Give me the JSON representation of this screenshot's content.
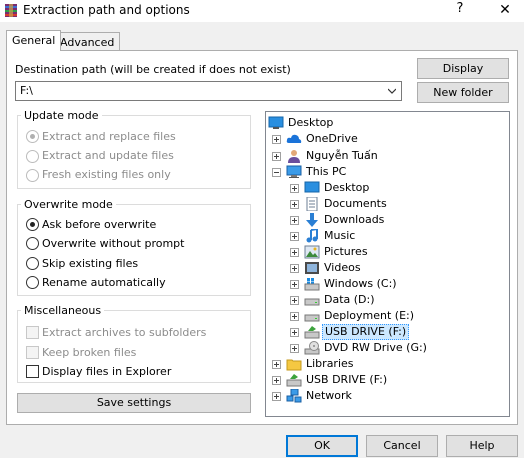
{
  "window": {
    "title": "Extraction path and options",
    "help_glyph": "?",
    "close_glyph": "✕"
  },
  "tabs": [
    {
      "label": "General"
    },
    {
      "label": "Advanced"
    }
  ],
  "destination": {
    "label": "Destination path (will be created if does not exist)",
    "value": "F:\\",
    "display_button": "Display",
    "new_folder_button": "New folder"
  },
  "update_mode": {
    "title": "Update mode",
    "options": [
      "Extract and replace files",
      "Extract and update files",
      "Fresh existing files only"
    ]
  },
  "overwrite_mode": {
    "title": "Overwrite mode",
    "options": [
      "Ask before overwrite",
      "Overwrite without prompt",
      "Skip existing files",
      "Rename automatically"
    ]
  },
  "misc": {
    "title": "Miscellaneous",
    "options": [
      "Extract archives to subfolders",
      "Keep broken files",
      "Display files in Explorer"
    ]
  },
  "save_settings": "Save settings",
  "tree": {
    "root": "Desktop",
    "level1": [
      "OneDrive",
      "Nguyễn Tuấn",
      "This PC"
    ],
    "this_pc": [
      "Desktop",
      "Documents",
      "Downloads",
      "Music",
      "Pictures",
      "Videos",
      "Windows (C:)",
      "Data (D:)",
      "Deployment (E:)",
      "USB DRIVE (F:)",
      "DVD RW Drive (G:)"
    ],
    "level1_after": [
      "Libraries",
      "USB DRIVE (F:)",
      "Network"
    ]
  },
  "buttons": {
    "ok": "OK",
    "cancel": "Cancel",
    "help": "Help"
  }
}
